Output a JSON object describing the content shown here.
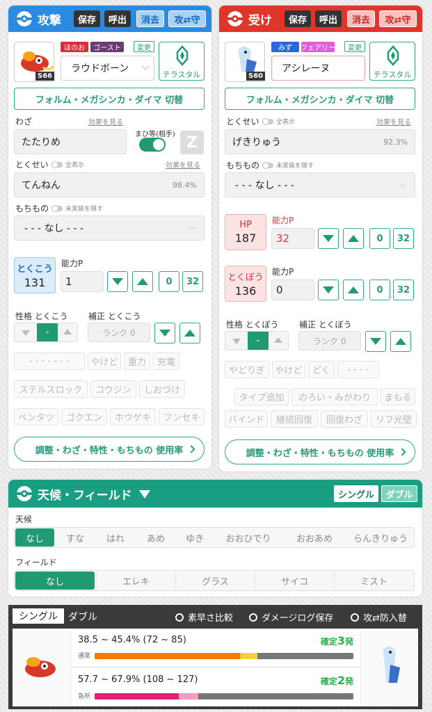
{
  "attack": {
    "title": "攻撃",
    "buttons": [
      "保存",
      "呼出",
      "消去",
      "攻⇄守"
    ],
    "types": [
      "ほのお",
      "ゴースト"
    ],
    "change_label": "変更",
    "level_badge": "S66",
    "pokemon_name": "ラウドボーン",
    "tera_label": "テラスタル",
    "form_switch": "フォルム・メガシンカ・ダイマ 切替",
    "move_label": "わざ",
    "move_effect_link": "効果を見る",
    "paralysis_label": "まひ等(相手)",
    "move_value": "たたりめ",
    "z_label": "Z",
    "ability_label": "とくせい",
    "show_all": "全表示",
    "ability_effect_link": "効果を見る",
    "ability_value": "てんねん",
    "ability_pct": "98.4%",
    "item_label": "もちもの",
    "hide_unimpl": "未実装を隠す",
    "item_value": "- - - なし - - -",
    "stat_name": "とくこう",
    "stat_value": "131",
    "ability_p_label": "能力P",
    "ability_p_value": "1",
    "btn_zero": "0",
    "btn_32": "32",
    "nature_label": "性格 とくこう",
    "nature_mid": "-",
    "correction_label": "補正 とくこう",
    "rank_placeholder": "ランク 0",
    "status_placeholder": "- - - - - - -",
    "chips_row1": [
      "やけど",
      "重力",
      "充電"
    ],
    "chips_row2": [
      "ステルスロック",
      "コウジン",
      "しおづけ"
    ],
    "chips_row3": [
      "ベンタツ",
      "ゴクエン",
      "ホウゲキ",
      "フンセキ"
    ],
    "usage_link": "調整・わざ・特性・もちもの 使用率"
  },
  "defense": {
    "title": "受け",
    "buttons": [
      "保存",
      "呼出",
      "消去",
      "攻⇄守"
    ],
    "types": [
      "みず",
      "フェアリー"
    ],
    "change_label": "変更",
    "level_badge": "S60",
    "pokemon_name": "アシレーヌ",
    "tera_label": "テラスタル",
    "form_switch": "フォルム・メガシンカ・ダイマ 切替",
    "ability_label": "とくせい",
    "show_all": "全表示",
    "ability_effect_link": "効果を見る",
    "ability_value": "げきりゅう",
    "ability_pct": "92.3%",
    "item_label": "もちもの",
    "hide_unimpl": "未実装を隠す",
    "item_value": "- - - なし - - -",
    "hp_label": "HP",
    "hp_value": "187",
    "hp_p_label": "能力P",
    "hp_p_value": "32",
    "stat_name": "とくぼう",
    "stat_value": "136",
    "stat_p_label": "能力P",
    "stat_p_value": "0",
    "btn_zero": "0",
    "btn_32": "32",
    "nature_label": "性格 とくぼう",
    "nature_mid": "-",
    "correction_label": "補正 とくぼう",
    "rank_placeholder": "ランク 0",
    "chips_row1": [
      "やどりぎ",
      "やけど",
      "どく",
      "- - - -"
    ],
    "chips_row2": [
      "タイプ追加",
      "のろい・みがわり",
      "まもる"
    ],
    "chips_row3": [
      "バインド",
      "継続回復",
      "回復わざ",
      "リフ光壁"
    ],
    "usage_link": "調整・わざ・特性・もちもの 使用率"
  },
  "weather": {
    "title": "天候・フィールド",
    "modes": [
      "シングル",
      "ダブル"
    ],
    "weather_label": "天候",
    "weather_options": [
      "なし",
      "すな",
      "はれ",
      "あめ",
      "ゆき",
      "おおひでり",
      "おおあめ",
      "らんきりゅう"
    ],
    "field_label": "フィールド",
    "field_options": [
      "なし",
      "エレキ",
      "グラス",
      "サイコ",
      "ミスト"
    ]
  },
  "result": {
    "tabs": [
      "シングル",
      "ダブル"
    ],
    "links": [
      "素早さ比較",
      "ダメージログ保存",
      "攻⇄防入替"
    ],
    "rows": [
      {
        "range": "38.5 ~ 45.4% (72 ~ 85)",
        "type": "通常",
        "verdict_prefix": "確定",
        "verdict_num": "3",
        "verdict_suffix": "発",
        "min": 38.5,
        "max": 45.4
      },
      {
        "range": "57.7 ~ 67.9% (108 ~ 127)",
        "type": "急所",
        "verdict_prefix": "確定",
        "verdict_num": "2",
        "verdict_suffix": "発",
        "min": 57.7,
        "max": 67.9
      }
    ]
  },
  "colors": {
    "attack": "#2a8be0",
    "defense": "#e0352b",
    "teal": "#1a9e82"
  }
}
